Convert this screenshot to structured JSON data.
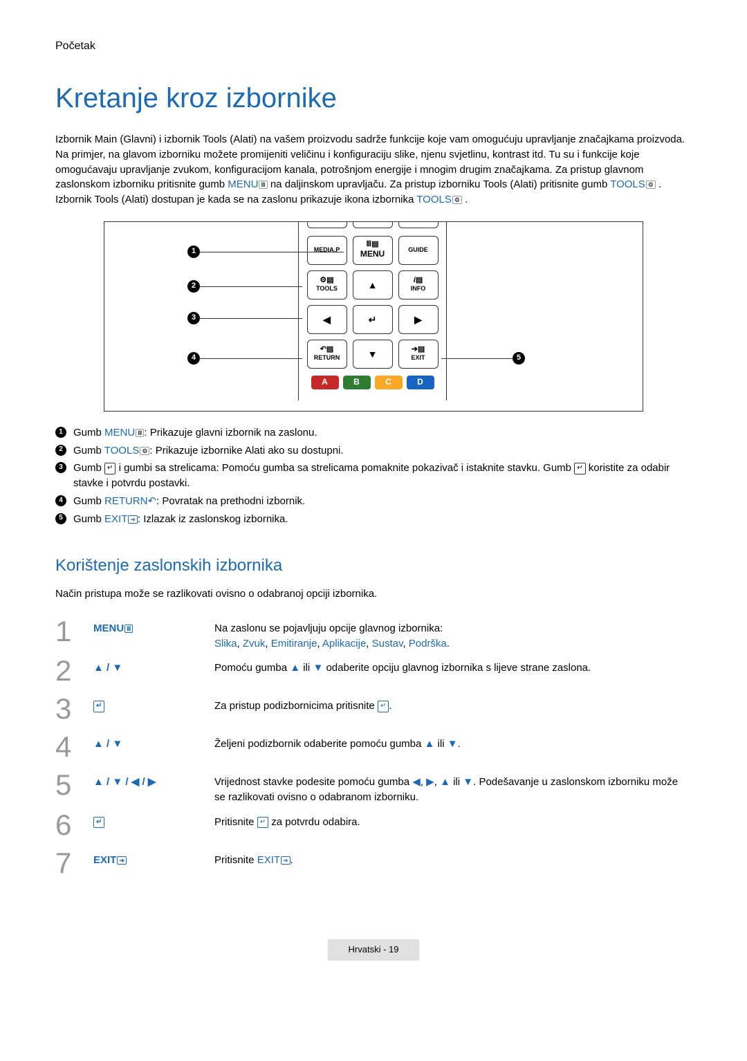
{
  "breadcrumb": "Početak",
  "title": "Kretanje kroz izbornike",
  "intro_parts": {
    "p1": "Izbornik Main (Glavni) i izbornik Tools (Alati) na vašem proizvodu sadrže funkcije koje vam omogućuju upravljanje značajkama proizvoda. Na primjer, na glavom izborniku možete promijeniti veličinu i konfiguraciju slike, njenu svjetlinu, kontrast itd. Tu su i funkcije koje omogućavaju upravljanje zvukom, konfiguracijom kanala, potrošnjom energije i mnogim drugim značajkama. Za pristup glavnom zaslonskom izborniku pritisnite gumb ",
    "menu": "MENU",
    "p2": " na daljinskom upravljaču. Za pristup izborniku Tools (Alati) pritisnite gumb ",
    "tools": "TOOLS",
    "p3": ". Izbornik Tools (Alati) dostupan je kada se na zaslonu prikazuje ikona izbornika ",
    "p4": "."
  },
  "remote": {
    "mediap": "MEDIA.P",
    "menu": "MENU",
    "guide": "GUIDE",
    "tools": "TOOLS",
    "info": "INFO",
    "return": "RETURN",
    "exit": "EXIT",
    "colorA": "A",
    "colorB": "B",
    "colorC": "C",
    "colorD": "D"
  },
  "legend": [
    {
      "num": "1",
      "pre": "Gumb ",
      "btn": "MENU",
      "post": ": Prikazuje glavni izbornik na zaslonu."
    },
    {
      "num": "2",
      "pre": "Gumb ",
      "btn": "TOOLS",
      "post": ": Prikazuje izbornike Alati ako su dostupni."
    },
    {
      "num": "3",
      "pre": "Gumb ",
      "btn": "",
      "post": " i gumbi sa strelicama: Pomoću gumba sa strelicama pomaknite pokazivač i istaknite stavku. Gumb ",
      "post2": " koristite za odabir stavke i potvrdu postavki."
    },
    {
      "num": "4",
      "pre": "Gumb ",
      "btn": "RETURN",
      "post": ": Povratak na prethodni izbornik."
    },
    {
      "num": "5",
      "pre": "Gumb ",
      "btn": "EXIT",
      "post": ": Izlazak iz zaslonskog izbornika."
    }
  ],
  "subheading": "Korištenje zaslonskih izbornika",
  "subintro": "Način pristupa može se razlikovati ovisno o odabranoj opciji izbornika.",
  "steps": [
    {
      "num": "1",
      "action_label": "MENU",
      "desc_pre": "Na zaslonu se pojavljuju opcije glavnog izbornika:",
      "desc_links": [
        "Slika",
        "Zvuk",
        "Emitiranje",
        "Aplikacije",
        "Sustav",
        "Podrška"
      ]
    },
    {
      "num": "2",
      "action_arrows": "▲ / ▼",
      "desc": "Pomoću gumba ▲ ili ▼ odaberite opciju glavnog izbornika s lijeve strane zaslona."
    },
    {
      "num": "3",
      "action_enter": true,
      "desc_pre": "Za pristup podizbornicima pritisnite ",
      "desc_post": "."
    },
    {
      "num": "4",
      "action_arrows": "▲ / ▼",
      "desc": "Željeni podizbornik odaberite pomoću gumba ▲ ili ▼."
    },
    {
      "num": "5",
      "action_arrows": "▲ / ▼ / ◀ / ▶",
      "desc": "Vrijednost stavke podesite pomoću gumba ◀, ▶, ▲ ili ▼. Podešavanje u zaslonskom izborniku može se razlikovati ovisno o odabranom izborniku."
    },
    {
      "num": "6",
      "action_enter": true,
      "desc_pre": "Pritisnite ",
      "desc_post": " za potvrdu odabira."
    },
    {
      "num": "7",
      "action_label": "EXIT",
      "desc_pre": "Pritisnite ",
      "desc_link": "EXIT",
      "desc_post": "."
    }
  ],
  "footer": "Hrvatski - 19"
}
